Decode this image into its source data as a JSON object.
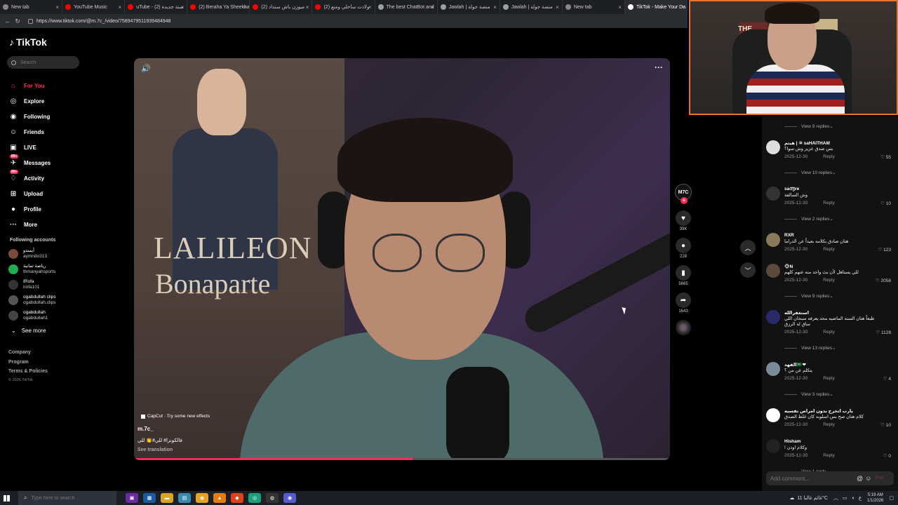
{
  "browser": {
    "tabs": [
      {
        "title": "New tab",
        "color": "#888888"
      },
      {
        "title": "YouTube Music",
        "color": "#ff0000"
      },
      {
        "title": "uTube - (2) سنة جديدة",
        "color": "#ff0000"
      },
      {
        "title": "(2) Beraha Ya Sheekha",
        "color": "#ff0000"
      },
      {
        "title": "(2) ميوزن باش سنداد",
        "color": "#ff0000"
      },
      {
        "title": "(2) ولادت ساحلي ومنع",
        "color": "#ff0000"
      },
      {
        "title": "The best ChatBot and",
        "color": "#9aa0a6"
      },
      {
        "title": "Jawlah | منصة جولة",
        "color": "#9aa0a6"
      },
      {
        "title": "Jawlah | منصة جولة",
        "color": "#9aa0a6"
      },
      {
        "title": "New tab",
        "color": "#888888"
      },
      {
        "title": "TikTok - Make Your Da",
        "color": "#ffffff",
        "active": true
      }
    ],
    "url": "https://www.tiktok.com/@m.7c_/video/7589479511939484948"
  },
  "sidebar": {
    "logo": "TikTok",
    "search_placeholder": "Search",
    "nav": [
      {
        "label": "For You",
        "icon": "home-icon",
        "glyph": "⌂",
        "active": true
      },
      {
        "label": "Explore",
        "icon": "compass-icon",
        "glyph": "◎"
      },
      {
        "label": "Following",
        "icon": "following-icon",
        "glyph": "◉"
      },
      {
        "label": "Friends",
        "icon": "friends-icon",
        "glyph": "☺"
      },
      {
        "label": "LIVE",
        "icon": "live-icon",
        "glyph": "▣"
      },
      {
        "label": "Messages",
        "icon": "messages-icon",
        "glyph": "✈",
        "badge": "99+"
      },
      {
        "label": "Activity",
        "icon": "activity-icon",
        "glyph": "♢",
        "badge": "99+"
      },
      {
        "label": "Upload",
        "icon": "upload-icon",
        "glyph": "⊞"
      },
      {
        "label": "Profile",
        "icon": "profile-icon",
        "glyph": "●"
      },
      {
        "label": "More",
        "icon": "more-icon",
        "glyph": "···"
      }
    ],
    "following_heading": "Following accounts",
    "accounts": [
      {
        "name": "أيمندو",
        "user": "aymndo313",
        "color": "#7a4a3a"
      },
      {
        "name": "رياضة ثمانية",
        "user": "thmanyahsports",
        "color": "#22aa55"
      },
      {
        "name": "IRofa",
        "user": "irofa101",
        "color": "#333333"
      },
      {
        "name": "ogabdullah clips",
        "user": "ogabdullah.clips",
        "color": "#555555"
      },
      {
        "name": "ogabdullah",
        "user": "ogabdullah1",
        "color": "#444444"
      }
    ],
    "see_more": "See more",
    "footer": [
      "Company",
      "Program",
      "Terms & Policies"
    ],
    "copyright": "© 2026 TikTok"
  },
  "video": {
    "poster_line1": "LALILEON",
    "poster_line2": "Bonaparte",
    "capcut_text": "CapCut · Try some new effects",
    "username": "m.7c_",
    "caption": "فالكونزا# للي#👏 للي",
    "see_translation": "See translation",
    "progress_fraction": 0.52
  },
  "actions": {
    "creator_initials": "M7C",
    "likes": "39K",
    "comments": "228",
    "saves": "5665",
    "shares": "1643"
  },
  "comments": {
    "items": [
      {
        "replies": "View 9 replies"
      },
      {
        "name": "هيثم | ⑩ saHAITHAM",
        "text": "بس صدق عزيز وش سوا؟",
        "date": "2025-12-30",
        "reply": "Reply",
        "likes": "55",
        "avatar": "#dddddd"
      },
      {
        "replies": "View 10 replies"
      },
      {
        "name": "sa൬re",
        "text": "وش السالفة",
        "date": "2025-12-30",
        "reply": "Reply",
        "likes": "10",
        "avatar": "#333333"
      },
      {
        "replies": "View 2 replies"
      },
      {
        "name": "RXR",
        "text": "هتان صادق بكلامه بعيداً عن الدراما",
        "date": "2025-12-30",
        "reply": "Reply",
        "likes": "123",
        "avatar": "#8a7a5a"
      },
      {
        "name": "🐵N",
        "text": "للي يستاهل لأن بث واحد منه عنهم كلهم",
        "date": "2025-12-30",
        "reply": "Reply",
        "likes": "2058",
        "avatar": "#5a4a3a"
      },
      {
        "replies": "View 9 replies"
      },
      {
        "name": "استغفرالله",
        "text": "طبعاً هتان السنه الماضيه محد يعرفه سبحان اللي ساق له الرزق",
        "date": "2025-12-30",
        "reply": "Reply",
        "likes": "1128",
        "avatar": "#2a2a6a"
      },
      {
        "replies": "View 13 replies"
      },
      {
        "name": "الفهد🇸🇦❤",
        "text": "يتكلم عن من ؟",
        "date": "2025-12-30",
        "reply": "Reply",
        "likes": "4",
        "avatar": "#7a8a9a"
      },
      {
        "replies": "View 3 replies"
      },
      {
        "name": "يارب اتخرج بدون امراض نفسيه",
        "text": "كلام هتان صح بس اسلوبه كان غلط الصدق",
        "date": "2025-12-30",
        "reply": "Reply",
        "likes": "10",
        "avatar": "#ffffff"
      },
      {
        "name": "Hisham",
        "text": "! وكلام اودن",
        "date": "2025-12-30",
        "reply": "Reply",
        "likes": "0",
        "avatar": "#222222"
      },
      {
        "replies": "View 1 reply"
      }
    ],
    "add_placeholder": "Add comment...",
    "post": "Post"
  },
  "webcam": {
    "poster_text": "THE"
  },
  "taskbar": {
    "search_placeholder": "Type here to search",
    "apps": [
      {
        "icon": "task-view-icon",
        "color": "#6a2aa0",
        "glyph": "▣"
      },
      {
        "icon": "store-icon",
        "color": "#1c5aa0",
        "glyph": "▦"
      },
      {
        "icon": "folder-icon",
        "color": "#d9a520",
        "glyph": "▬"
      },
      {
        "icon": "notepad-icon",
        "color": "#3a8ab0",
        "glyph": "▤"
      },
      {
        "icon": "chrome-icon",
        "color": "#e8a020",
        "glyph": "◉"
      },
      {
        "icon": "vlc-icon",
        "color": "#e87a10",
        "glyph": "▲"
      },
      {
        "icon": "brave-icon",
        "color": "#e0401a",
        "glyph": "◆"
      },
      {
        "icon": "edge-icon",
        "color": "#1aa07a",
        "glyph": "◎"
      },
      {
        "icon": "obs-icon",
        "color": "#333333",
        "glyph": "◍"
      },
      {
        "icon": "app-icon",
        "color": "#5a5ad0",
        "glyph": "◉"
      }
    ],
    "weather": "غائم غالبا 11°C",
    "lang": "ع",
    "time": "5:19 AM",
    "date": "1/1/2026"
  }
}
